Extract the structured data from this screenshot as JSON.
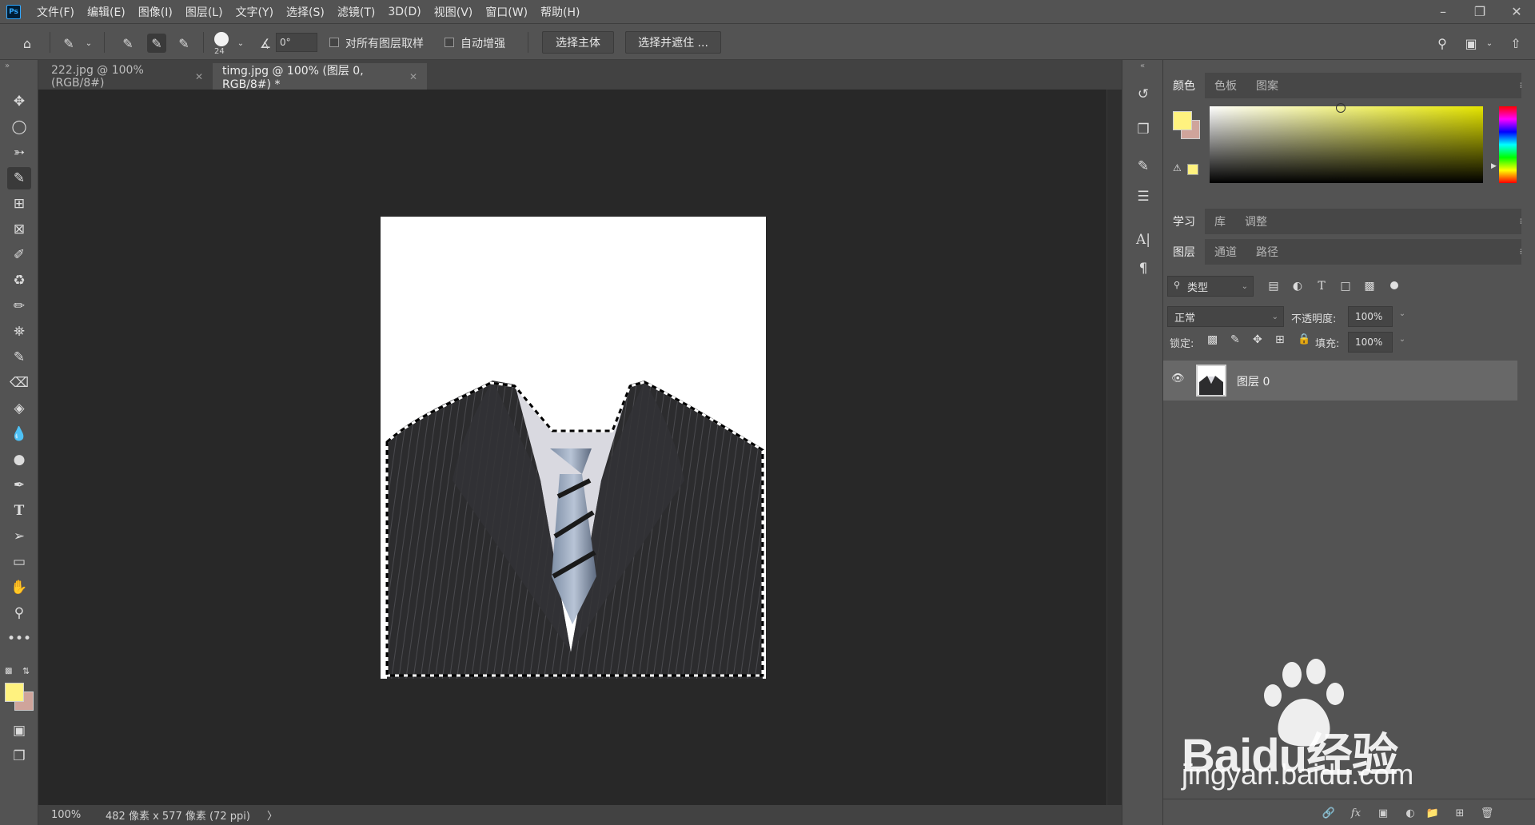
{
  "app": {
    "logo": "Ps",
    "menu": [
      "文件(F)",
      "编辑(E)",
      "图像(I)",
      "图层(L)",
      "文字(Y)",
      "选择(S)",
      "滤镜(T)",
      "3D(D)",
      "视图(V)",
      "窗口(W)",
      "帮助(H)"
    ],
    "window_controls": [
      "minimize-icon",
      "restore-icon",
      "close-icon"
    ]
  },
  "options_bar": {
    "brush_size": "24",
    "angle_value": "0°",
    "sample_all_layers_label": "对所有图层取样",
    "sample_all_layers_checked": false,
    "auto_enhance_label": "自动增强",
    "auto_enhance_checked": false,
    "select_subject_button": "选择主体",
    "select_and_mask_button": "选择并遮住 ..."
  },
  "tabs": [
    {
      "label": "222.jpg @ 100%(RGB/8#)",
      "active": false
    },
    {
      "label": "timg.jpg @ 100% (图层 0, RGB/8#) *",
      "active": true
    }
  ],
  "status_bar": {
    "zoom": "100%",
    "doc_info": "482 像素 x 577 像素 (72 ppi)",
    "arrow": "〉"
  },
  "color_panel": {
    "tabs": [
      "颜色",
      "色板",
      "图案"
    ],
    "active_tab": "颜色",
    "foreground_color": "#fff27f",
    "background_color": "#cfa49b"
  },
  "learn_panel": {
    "tabs": [
      "学习",
      "库",
      "调整"
    ]
  },
  "layers_panel": {
    "tabs": [
      "图层",
      "通道",
      "路径"
    ],
    "active_tab": "图层",
    "filter_kind": "类型",
    "blend_mode": "正常",
    "opacity_label": "不透明度:",
    "opacity_value": "100%",
    "lock_label": "锁定:",
    "fill_label": "填充:",
    "fill_value": "100%",
    "layers": [
      {
        "name": "图层 0",
        "visible": true,
        "selected": true
      }
    ],
    "bottom_icons": [
      "link-icon",
      "fx-icon",
      "mask-icon",
      "adjustment-icon",
      "folder-icon",
      "new-layer-icon",
      "trash-icon"
    ],
    "fx_label": "fx"
  },
  "watermark": {
    "brand": "Baidu经验",
    "url": "jingyan.baidu.com"
  }
}
